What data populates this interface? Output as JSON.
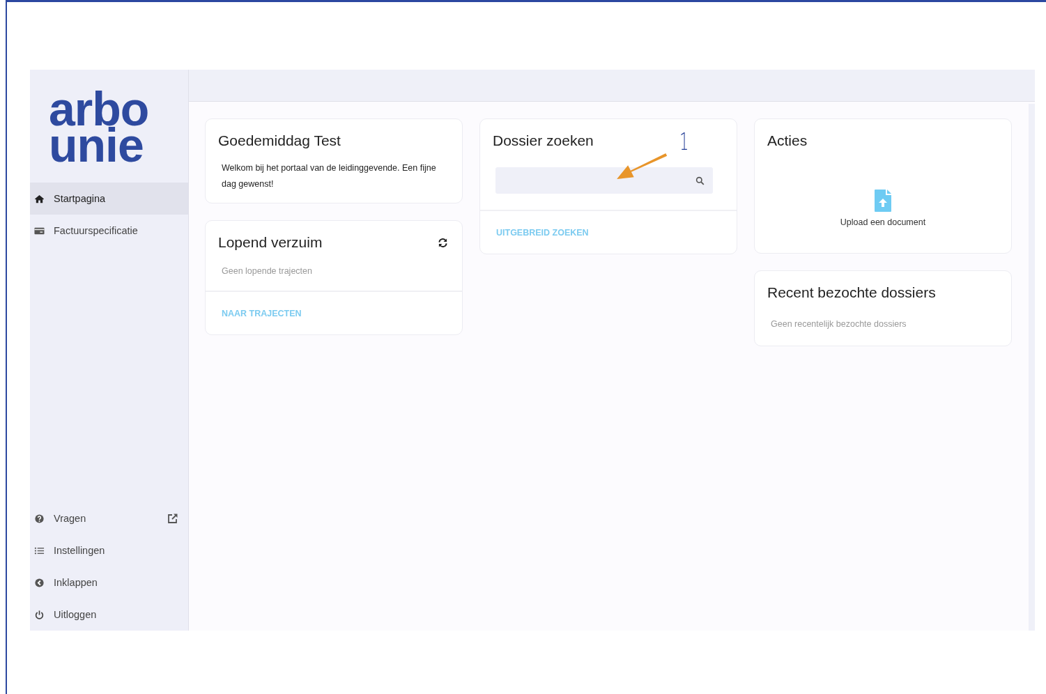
{
  "logo": {
    "line_1": "arbo",
    "line_2": "unie"
  },
  "sidebar": {
    "items": [
      {
        "kind": "home",
        "label": "Startpagina",
        "selected": true
      },
      {
        "kind": "card",
        "label": "Factuurspecificatie",
        "selected": false
      }
    ],
    "bottom_items": [
      {
        "kind": "question",
        "label": "Vragen",
        "external": true,
        "selected": false
      },
      {
        "kind": "list",
        "label": "Instellingen",
        "external": false,
        "selected": false
      },
      {
        "kind": "collapse",
        "label": "Inklappen",
        "external": false,
        "selected": false
      },
      {
        "kind": "power",
        "label": "Uitloggen",
        "external": false,
        "selected": false
      }
    ]
  },
  "columns": [
    [
      {
        "kind": "text",
        "title": "Goedemiddag Test",
        "body": "Welkom bij het portaal van de leidinggevende. Een fijne dag gewenst!"
      },
      {
        "kind": "status",
        "title": "Lopend verzuim",
        "refresh": true,
        "empty_text": "Geen lopende trajecten",
        "link": "NAAR TRAJECTEN"
      }
    ],
    [
      {
        "kind": "search",
        "title": "Dossier zoeken",
        "annotation": "1",
        "link": "UITGEBREID ZOEKEN"
      }
    ],
    [
      {
        "kind": "actions",
        "title": "Acties",
        "actions": [
          {
            "label": "Upload een document"
          }
        ]
      },
      {
        "kind": "empty",
        "title": "Recent bezochte dossiers",
        "empty_text": "Geen recentelijk bezochte dossiers"
      }
    ]
  ]
}
